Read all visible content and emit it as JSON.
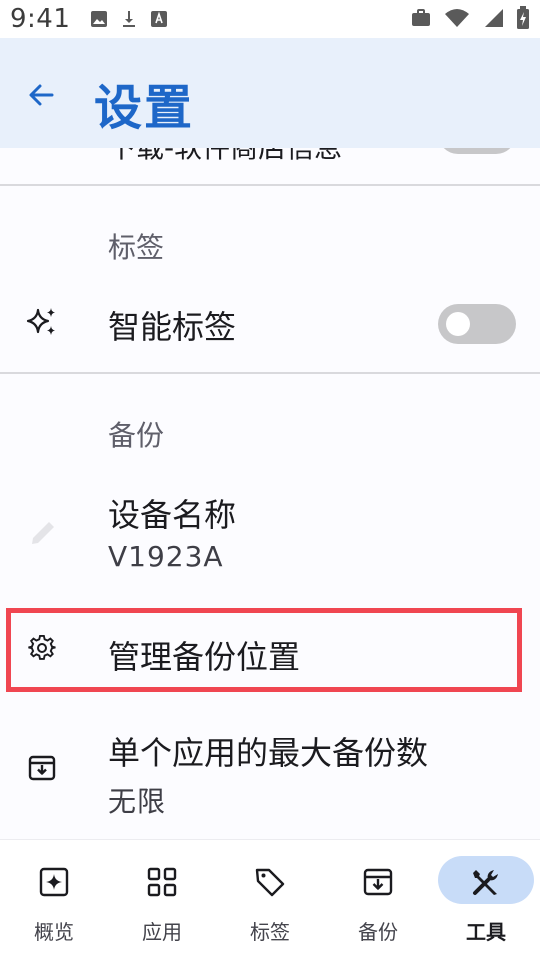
{
  "status_bar": {
    "time": "9:41"
  },
  "header": {
    "title": "设置",
    "back_icon": "arrow-left-icon"
  },
  "settings": {
    "cut_off_item": {
      "title": "下载-软件商店信息"
    },
    "section_tags": {
      "label": "标签",
      "smart_tags": {
        "title": "智能标签",
        "enabled": false
      }
    },
    "section_backup": {
      "label": "备份",
      "device_name": {
        "title": "设备名称",
        "value": "V1923A"
      },
      "manage_location": {
        "title": "管理备份位置"
      },
      "max_backups": {
        "title": "单个应用的最大备份数",
        "value": "无限"
      }
    }
  },
  "highlight_color": "#f04651",
  "accent_color": "#1e67c8",
  "bottom_nav": {
    "items": [
      {
        "label": "概览",
        "icon": "overview-icon",
        "active": false
      },
      {
        "label": "应用",
        "icon": "apps-grid-icon",
        "active": false
      },
      {
        "label": "标签",
        "icon": "tag-icon",
        "active": false
      },
      {
        "label": "备份",
        "icon": "archive-icon",
        "active": false
      },
      {
        "label": "工具",
        "icon": "tools-icon",
        "active": true
      }
    ]
  }
}
